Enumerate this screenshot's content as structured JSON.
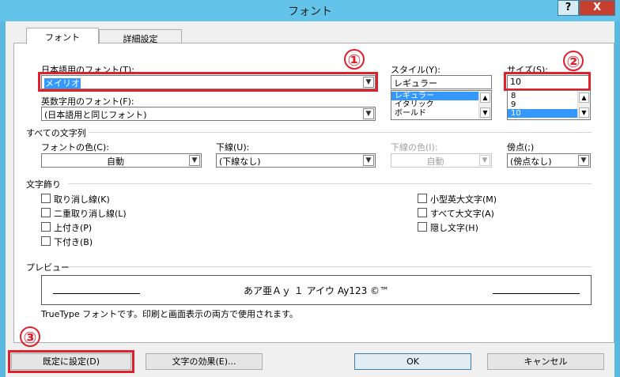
{
  "window": {
    "title": "フォント",
    "help": "?",
    "close": "X"
  },
  "tabs": [
    {
      "label": "フォント"
    },
    {
      "label": "詳細設定"
    }
  ],
  "jp_font": {
    "label": "日本語用のフォント(T):",
    "value": "メイリオ"
  },
  "en_font": {
    "label": "英数字用のフォント(F):",
    "value": "(日本語用と同じフォント)"
  },
  "style": {
    "label": "スタイル(Y):",
    "value": "レギュラー",
    "options": [
      "レギュラー",
      "イタリック",
      "ボールド"
    ]
  },
  "size": {
    "label": "サイズ(S):",
    "value": "10",
    "options": [
      "8",
      "9",
      "10"
    ]
  },
  "all_text_section": "すべての文字列",
  "font_color": {
    "label": "フォントの色(C):",
    "value": "自動"
  },
  "underline": {
    "label": "下線(U):",
    "value": "(下線なし)"
  },
  "underline_color": {
    "label": "下線の色(I):",
    "value": "自動"
  },
  "emphasis": {
    "label": "傍点(;)",
    "value": "(傍点なし)"
  },
  "effects_section": "文字飾り",
  "effects_left": [
    "取り消し線(K)",
    "二重取り消し線(L)",
    "上付き(P)",
    "下付き(B)"
  ],
  "effects_right": [
    "小型英大文字(M)",
    "すべて大文字(A)",
    "隠し文字(H)"
  ],
  "preview": {
    "label": "プレビュー",
    "sample": "あア亜Ａｙ １ アイウ Ay123 ©™",
    "note": "TrueType フォントです。印刷と画面表示の両方で使用されます。"
  },
  "buttons": {
    "default": "既定に設定(D)",
    "effects": "文字の効果(E)...",
    "ok": "OK",
    "cancel": "キャンセル"
  },
  "markers": [
    "①",
    "②",
    "③"
  ]
}
